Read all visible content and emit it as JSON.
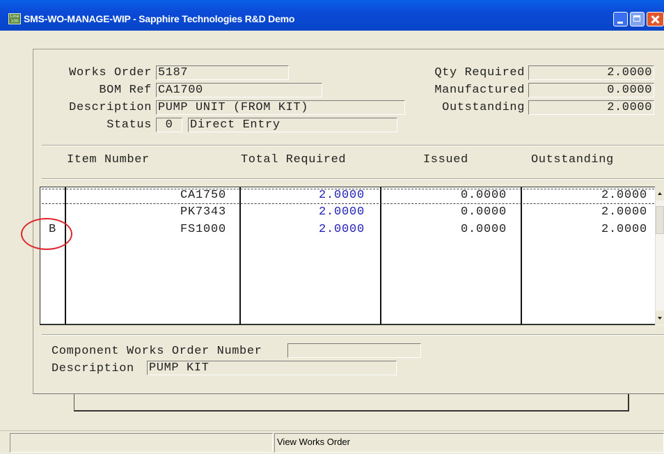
{
  "window": {
    "app_icon_text": "Line 100",
    "title": "SMS-WO-MANAGE-WIP - Sapphire Technologies R&D Demo"
  },
  "header": {
    "works_order_label": "Works Order",
    "works_order_value": "5187",
    "bom_ref_label": "BOM Ref",
    "bom_ref_value": "CA1700",
    "description_label": "Description",
    "description_value": "PUMP UNIT (FROM KIT)",
    "status_label": "Status",
    "status_code": "0",
    "status_text": "Direct Entry",
    "qty_required_label": "Qty Required",
    "qty_required_value": "2.0000",
    "manufactured_label": "Manufactured",
    "manufactured_value": "0.0000",
    "outstanding_label": "Outstanding",
    "outstanding_value": "2.0000"
  },
  "grid": {
    "columns": [
      "Item Number",
      "Total Required",
      "Issued",
      "Outstanding"
    ],
    "rows": [
      {
        "flag": "",
        "item": "CA1750",
        "total_required": "2.0000",
        "issued": "0.0000",
        "outstanding": "2.0000"
      },
      {
        "flag": "",
        "item": "PK7343",
        "total_required": "2.0000",
        "issued": "0.0000",
        "outstanding": "2.0000"
      },
      {
        "flag": "B",
        "item": "FS1000",
        "total_required": "2.0000",
        "issued": "0.0000",
        "outstanding": "2.0000"
      }
    ]
  },
  "component": {
    "works_order_number_label": "Component Works Order Number",
    "works_order_number_value": "",
    "description_label": "Description",
    "description_value": "PUMP KIT"
  },
  "status_bar": {
    "left": "",
    "right": "View Works Order"
  },
  "colors": {
    "title_bar": "#0a4ad6",
    "window_bg": "#ece9d8",
    "total_required_text": "#1f1fb8",
    "annotation_circle": "#e0252d"
  }
}
